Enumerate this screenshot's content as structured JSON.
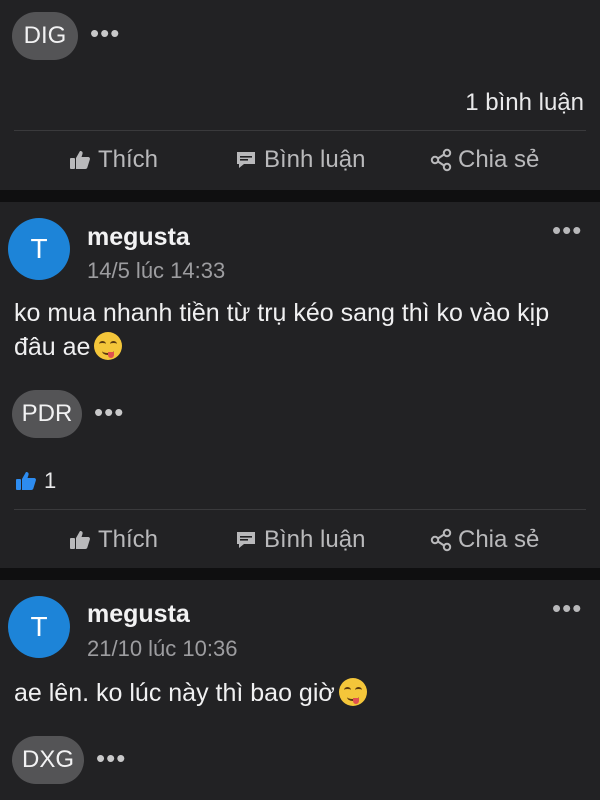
{
  "post0": {
    "tag": "DIG",
    "comment_count": "1 bình luận",
    "actions": {
      "like": "Thích",
      "comment": "Bình luận",
      "share": "Chia sẻ"
    }
  },
  "post1": {
    "avatar_letter": "T",
    "author": "megusta",
    "time": "14/5 lúc 14:33",
    "text": "ko mua nhanh tiền từ trụ kéo sang thì ko vào kịp đâu ae",
    "tag": "PDR",
    "likes": "1",
    "actions": {
      "like": "Thích",
      "comment": "Bình luận",
      "share": "Chia sẻ"
    }
  },
  "post2": {
    "avatar_letter": "T",
    "author": "megusta",
    "time": "21/10 lúc 10:36",
    "text": "ae lên. ko lúc này thì bao giờ",
    "tag": "DXG"
  },
  "more_glyph": "•••",
  "colors": {
    "avatar": "#1d84d8",
    "like_blue": "#2d8cf0",
    "card": "#222224",
    "background": "#0f0f10"
  }
}
